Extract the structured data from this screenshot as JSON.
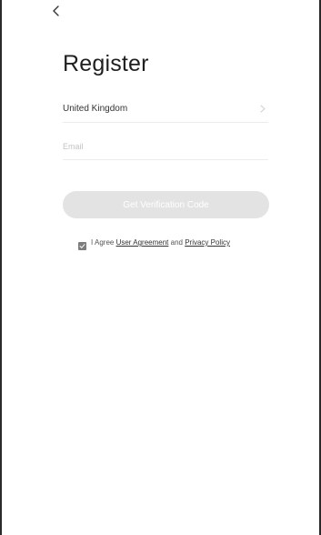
{
  "header": {
    "back_icon": "chevron-left-icon"
  },
  "page": {
    "title": "Register"
  },
  "form": {
    "country": {
      "value": "United Kingdom",
      "icon": "chevron-right-icon"
    },
    "email": {
      "value": "",
      "placeholder": "Email"
    },
    "verify_button_label": "Get Verification Code",
    "agreement": {
      "checked": true,
      "prefix": "I Agree ",
      "user_agreement_link": "User Agreement",
      "conjunction": " and ",
      "privacy_policy_link": "Privacy Policy"
    }
  },
  "colors": {
    "button_disabled_bg": "#e3e3e3",
    "button_text": "#ffffff",
    "checkbox": "#7d7d7d",
    "divider": "#ececec",
    "title": "#1f1f1f"
  }
}
